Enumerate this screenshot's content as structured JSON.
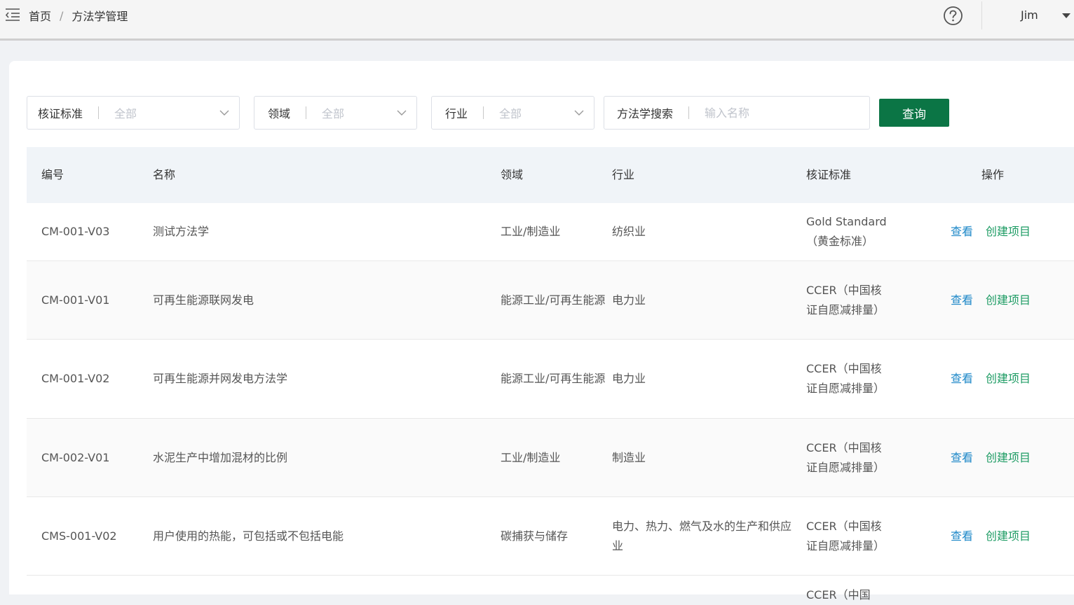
{
  "breadcrumb": {
    "home": "首页",
    "separator": "/",
    "current": "方法学管理"
  },
  "user": {
    "name": "Jim"
  },
  "icons": {
    "menu": "menu-fold-icon",
    "help": "question-circle-icon",
    "caret": "caret-down-icon",
    "chevron": "chevron-down-icon"
  },
  "filters": {
    "standard": {
      "label": "核证标准",
      "value": "全部"
    },
    "domain": {
      "label": "领域",
      "value": "全部"
    },
    "industry": {
      "label": "行业",
      "value": "全部"
    },
    "search": {
      "label": "方法学搜索",
      "placeholder": "输入名称",
      "value": ""
    },
    "query_button": "查询"
  },
  "table": {
    "headers": {
      "code": "编号",
      "name": "名称",
      "domain": "领域",
      "industry": "行业",
      "standard": "核证标准",
      "ops": "操作"
    },
    "rows": [
      {
        "code": "CM-001-V03",
        "name": "测试方法学",
        "domain": "工业/制造业",
        "industry": "纺织业",
        "standard": "Gold Standard（黄金标准）",
        "view": "查看",
        "create": "创建项目"
      },
      {
        "code": "CM-001-V01",
        "name": "可再生能源联网发电",
        "domain": "能源工业/可再生能源",
        "industry": "电力业",
        "standard": "CCER（中国核证自愿减排量）",
        "view": "查看",
        "create": "创建项目"
      },
      {
        "code": "CM-001-V02",
        "name": "可再生能源并网发电方法学",
        "domain": "能源工业/可再生能源",
        "industry": "电力业",
        "standard": "CCER（中国核证自愿减排量）",
        "view": "查看",
        "create": "创建项目"
      },
      {
        "code": "CM-002-V01",
        "name": "水泥生产中增加混材的比例",
        "domain": "工业/制造业",
        "industry": "制造业",
        "standard": "CCER（中国核证自愿减排量）",
        "view": "查看",
        "create": "创建项目"
      },
      {
        "code": "CMS-001-V02",
        "name": "用户使用的热能，可包括或不包括电能",
        "domain": "碳捕获与储存",
        "industry": "电力、热力、燃气及水的生产和供应业",
        "standard": "CCER（中国核证自愿减排量）",
        "view": "查看",
        "create": "创建项目"
      },
      {
        "code": "",
        "name": "",
        "domain": "",
        "industry": "",
        "standard": "CCER（中国",
        "view": "",
        "create": ""
      }
    ]
  },
  "colors": {
    "primary": "#0b7545",
    "link_view": "#1e88c8",
    "link_create": "#1c9b63"
  }
}
